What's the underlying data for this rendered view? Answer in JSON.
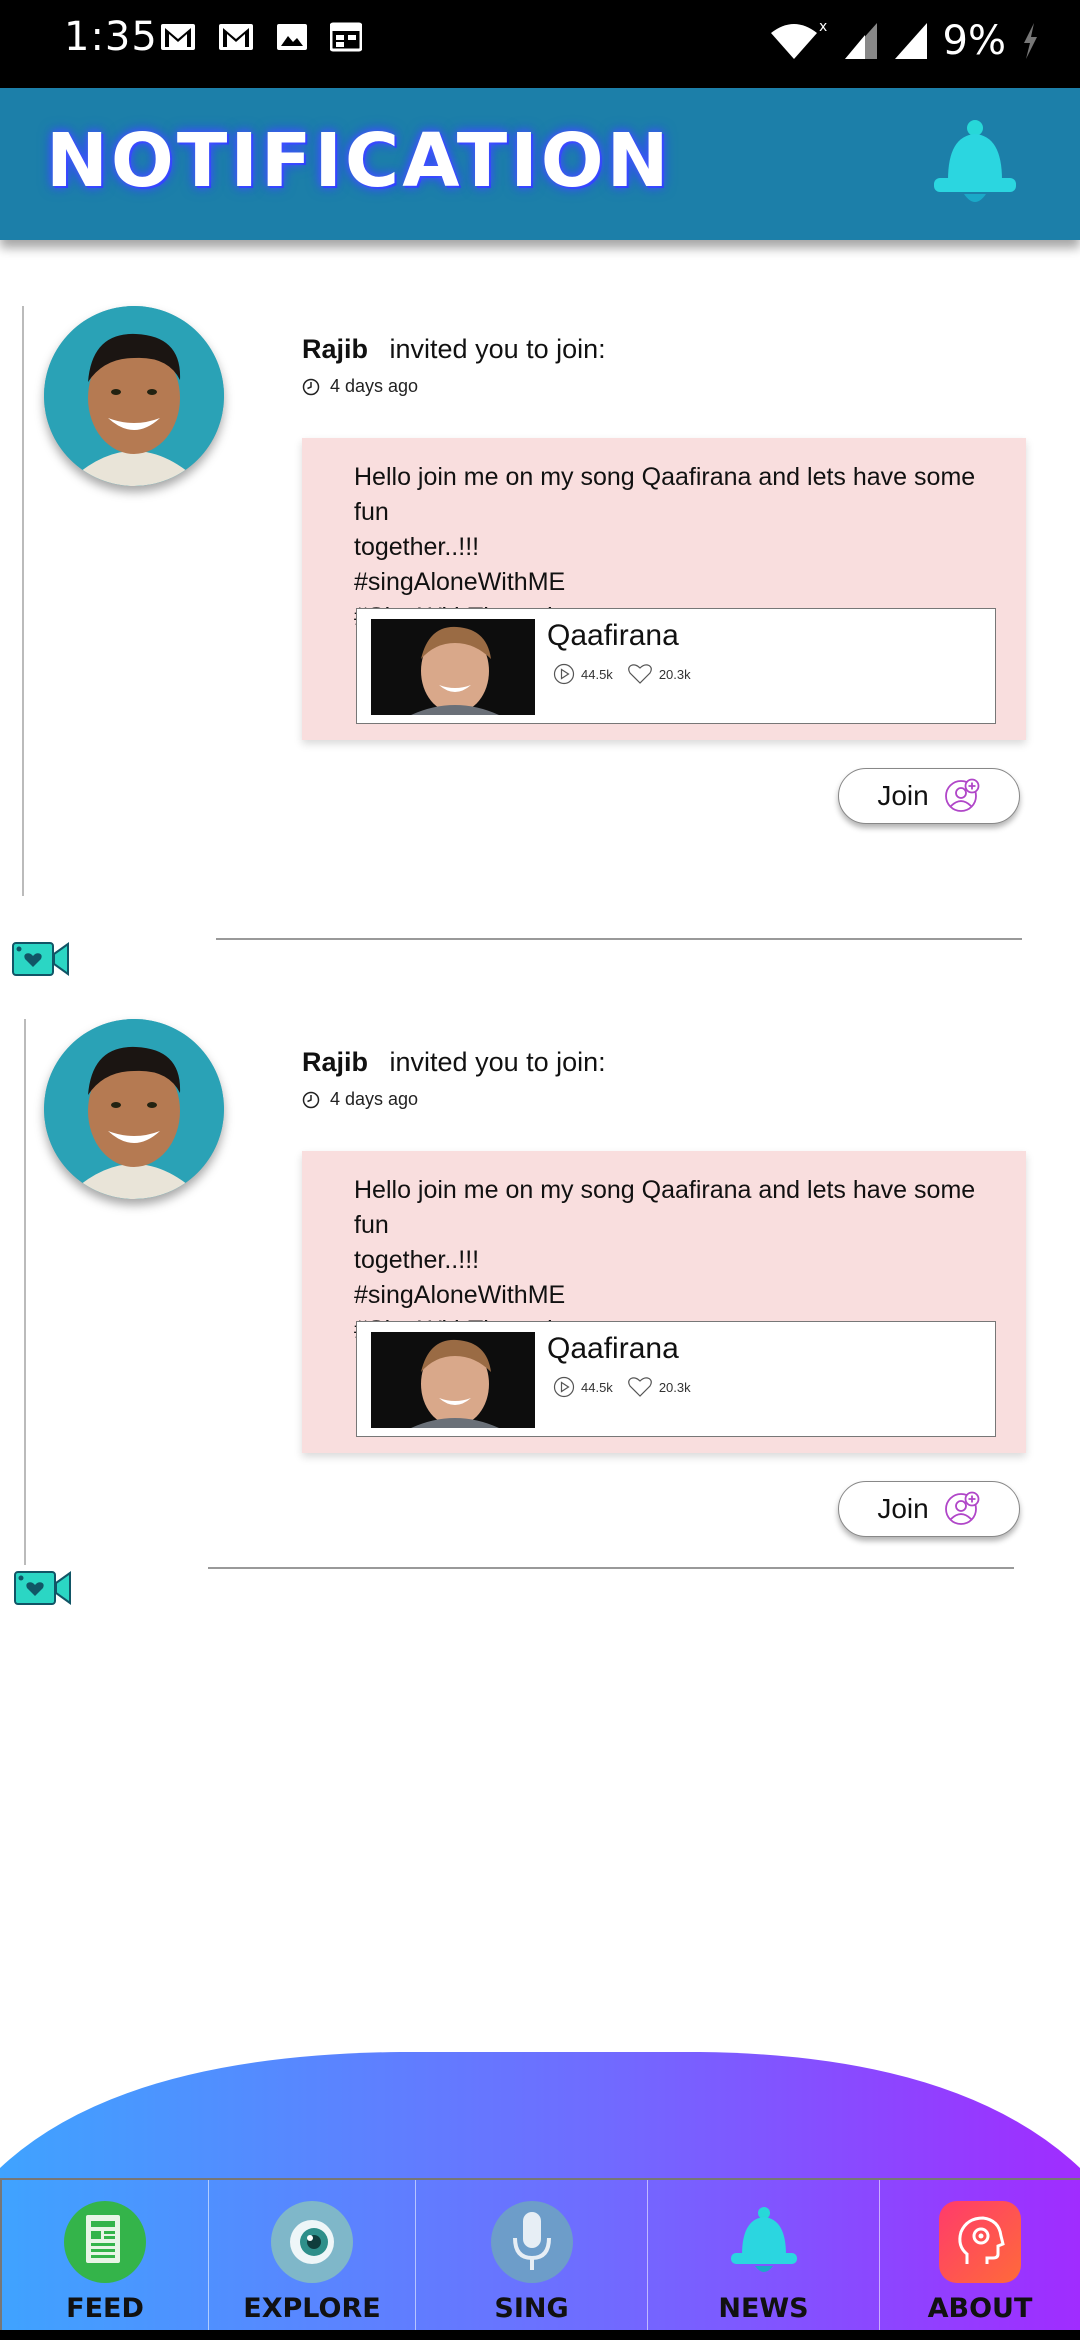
{
  "status_bar": {
    "time": "1:35",
    "battery": "9%",
    "icons_left": [
      "gmail-icon",
      "gmail-icon",
      "image-icon",
      "calendar-icon"
    ],
    "icons_right": [
      "wifi-icon",
      "signal-icon",
      "signal-icon",
      "charging-icon"
    ]
  },
  "header": {
    "title": "NOTIFICATION",
    "icon": "bell-icon"
  },
  "notifications": [
    {
      "name": "Rajib",
      "action": "invited you to join:",
      "time": "4 days ago",
      "message": "Hello join me  on my song Qaafirana and lets have some fun\n together..!!!\n#singAloneWithME\n#SingWithThe artists",
      "song": {
        "title": "Qaafirana",
        "plays": "44.5k",
        "likes": "20.3k"
      },
      "join_label": "Join"
    },
    {
      "name": "Rajib",
      "action": "invited you to join:",
      "time": "4 days ago",
      "message": "Hello join me  on my song Qaafirana and lets have some fun\n together..!!!\n#singAloneWithME\n#SingWithThe artists",
      "song": {
        "title": "Qaafirana",
        "plays": "44.5k",
        "likes": "20.3k"
      },
      "join_label": "Join"
    }
  ],
  "bottom_nav": {
    "items": [
      {
        "label": "FEED",
        "icon": "feed-icon"
      },
      {
        "label": "EXPLORE",
        "icon": "eye-icon"
      },
      {
        "label": "SING",
        "icon": "microphone-icon"
      },
      {
        "label": "NEWS",
        "icon": "bell-icon"
      },
      {
        "label": "ABOUT",
        "icon": "head-gear-icon"
      }
    ],
    "active": "NEWS"
  },
  "colors": {
    "header": "#1c7fa9",
    "message_bg": "#f9dede",
    "nav_gradient_start": "#3fa3ff",
    "nav_gradient_end": "#a02cff"
  }
}
